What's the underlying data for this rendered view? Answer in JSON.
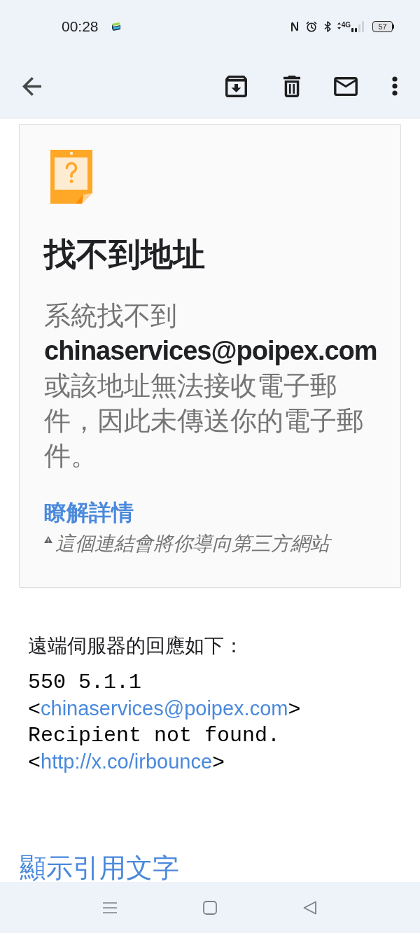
{
  "status_bar": {
    "time": "00:28",
    "network": "4G",
    "battery": "57"
  },
  "notice_card": {
    "title": "找不到地址",
    "message": "系統找不到 **chinaservices@poipex.com** 或該地址無法接收電子郵件，因此未傳送你的電子郵件。",
    "learn_more_link": "瞭解詳情",
    "warning": "這個連結會將你導向第三方網站"
  },
  "server_response": {
    "intro": "遠端伺服器的回應如下：",
    "lines": [
      {
        "kind": "text",
        "text": "550 5.1.1"
      },
      {
        "kind": "email_link",
        "before": "<",
        "link": "chinaservices@poipex.com",
        "after": ">"
      },
      {
        "kind": "text",
        "text": "Recipient not found."
      },
      {
        "kind": "url_link",
        "before": "<",
        "link": "http://x.co/irbounce",
        "after": ">"
      }
    ]
  },
  "show_quoted_text": "顯示引用文字"
}
